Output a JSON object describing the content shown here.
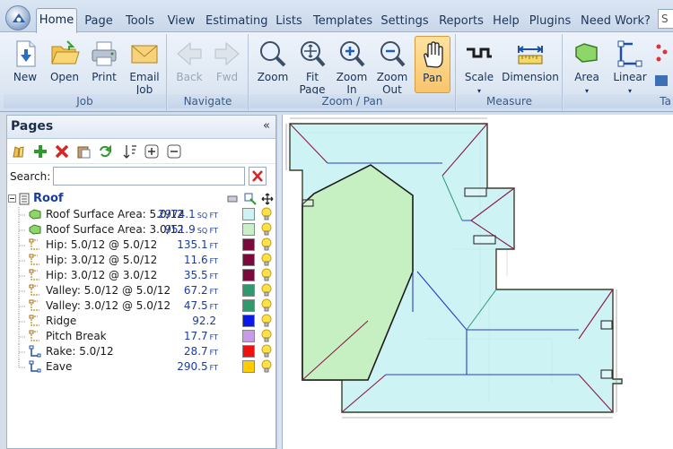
{
  "menu": {
    "tabs": [
      {
        "label": "Home"
      },
      {
        "label": "Page"
      },
      {
        "label": "Tools"
      },
      {
        "label": "View"
      },
      {
        "label": "Estimating"
      },
      {
        "label": "Lists"
      },
      {
        "label": "Templates"
      },
      {
        "label": "Settings"
      },
      {
        "label": "Reports"
      },
      {
        "label": "Help"
      },
      {
        "label": "Plugins"
      },
      {
        "label": "Need Work?"
      }
    ],
    "search_fragment": "S"
  },
  "ribbon": {
    "groups": {
      "job": "Job",
      "navigate": "Navigate",
      "zoom_pan": "Zoom / Pan",
      "measure": "Measure",
      "takeoff": "Ta"
    },
    "buttons": {
      "new": "New",
      "open": "Open",
      "print": "Print",
      "email_1": "Email",
      "email_2": "Job",
      "back": "Back",
      "fwd": "Fwd",
      "zoom": "Zoom",
      "fit_1": "Fit",
      "fit_2": "Page",
      "zoomin_1": "Zoom",
      "zoomin_2": "In",
      "zoomout_1": "Zoom",
      "zoomout_2": "Out",
      "pan": "Pan",
      "scale": "Scale",
      "dimension": "Dimension",
      "area": "Area",
      "linear": "Linear"
    }
  },
  "pages": {
    "title": "Pages",
    "collapse": "«",
    "search_label": "Search:",
    "search_value": "",
    "root": "Roof",
    "items": [
      {
        "label": "Roof Surface Area: 5.0/12",
        "value": "2974.1",
        "unit": "SQ FT",
        "color": "#ccf2f2",
        "icon": "area"
      },
      {
        "label": "Roof Surface Area: 3.0/12",
        "value": "951.9",
        "unit": "SQ FT",
        "color": "#c8f0c8",
        "icon": "area"
      },
      {
        "label": "Hip: 5.0/12 @ 5.0/12",
        "value": "135.1",
        "unit": "FT",
        "color": "#7a0a3c",
        "icon": "linear"
      },
      {
        "label": "Hip: 3.0/12 @ 5.0/12",
        "value": "11.6",
        "unit": "FT",
        "color": "#7a0a3c",
        "icon": "linear"
      },
      {
        "label": "Hip: 3.0/12 @ 3.0/12",
        "value": "35.5",
        "unit": "FT",
        "color": "#7a0a3c",
        "icon": "linear"
      },
      {
        "label": "Valley: 5.0/12 @ 5.0/12",
        "value": "67.2",
        "unit": "FT",
        "color": "#2e9a6e",
        "icon": "linear"
      },
      {
        "label": "Valley: 3.0/12 @ 5.0/12",
        "value": "47.5",
        "unit": "FT",
        "color": "#2e9a6e",
        "icon": "linear"
      },
      {
        "label": "Ridge",
        "value": "92.2",
        "unit": "",
        "color": "#0a18e8",
        "icon": "linear"
      },
      {
        "label": "Pitch Break",
        "value": "17.7",
        "unit": "FT",
        "color": "#c79be8",
        "icon": "linear"
      },
      {
        "label": "Rake: 5.0/12",
        "value": "28.7",
        "unit": "FT",
        "color": "#ee1111",
        "icon": "linear2"
      },
      {
        "label": "Eave",
        "value": "290.5",
        "unit": "FT",
        "color": "#ffcc00",
        "icon": "linear2"
      }
    ]
  }
}
